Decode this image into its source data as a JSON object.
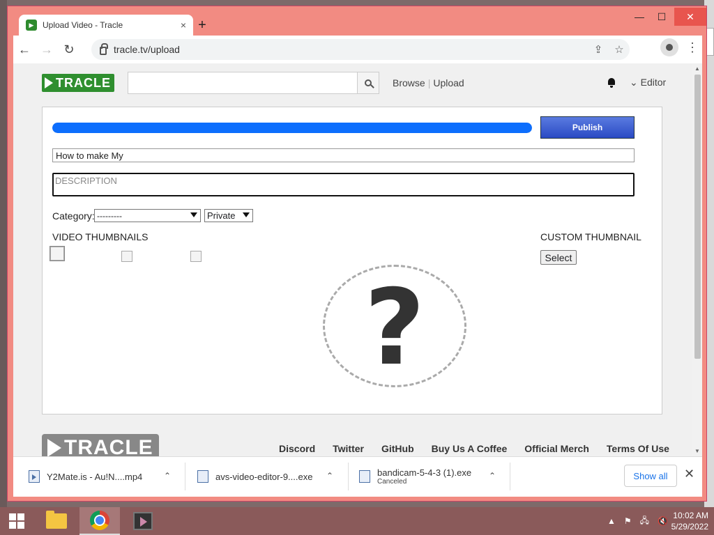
{
  "browser": {
    "tab_title": "Upload Video - Tracle",
    "tab_close": "×",
    "new_tab": "+",
    "url": "tracle.tv/upload",
    "window_controls": {
      "minimize": "—",
      "maximize": "☐",
      "close": "✕"
    }
  },
  "site": {
    "logo_text": "TRACLE",
    "search_placeholder": "",
    "nav": {
      "browse": "Browse",
      "separator": "|",
      "upload": "Upload"
    },
    "user_menu": "⌄ Editor"
  },
  "upload": {
    "progress_percent": 100,
    "publish_label": "Publish",
    "title_value": "How to make My",
    "description_placeholder": "DESCRIPTION",
    "category_label": "Category:",
    "category_selected": "---------",
    "privacy_selected": "Private",
    "thumbnails_heading": "VIDEO THUMBNAILS",
    "custom_thumbnail_heading": "CUSTOM THUMBNAIL",
    "select_label": "Select",
    "placeholder_glyph": "?"
  },
  "footer": {
    "logo_text": "TRACLE",
    "links": [
      "Discord",
      "Twitter",
      "GitHub",
      "Buy Us A Coffee",
      "Official Merch",
      "Terms Of Use"
    ]
  },
  "downloads": {
    "items": [
      {
        "name": "Y2Mate.is - Au!N....mp4",
        "status": ""
      },
      {
        "name": "avs-video-editor-9....exe",
        "status": ""
      },
      {
        "name": "bandicam-5-4-3 (1).exe",
        "status": "Canceled"
      }
    ],
    "show_all": "Show all",
    "close": "✕"
  },
  "taskbar": {
    "time": "10:02 AM",
    "date": "5/29/2022",
    "tray_up": "▲",
    "colors": {
      "taskbar": "#8a5a5a",
      "window_frame": "#f28b82",
      "accent": "#0d6efd"
    }
  }
}
